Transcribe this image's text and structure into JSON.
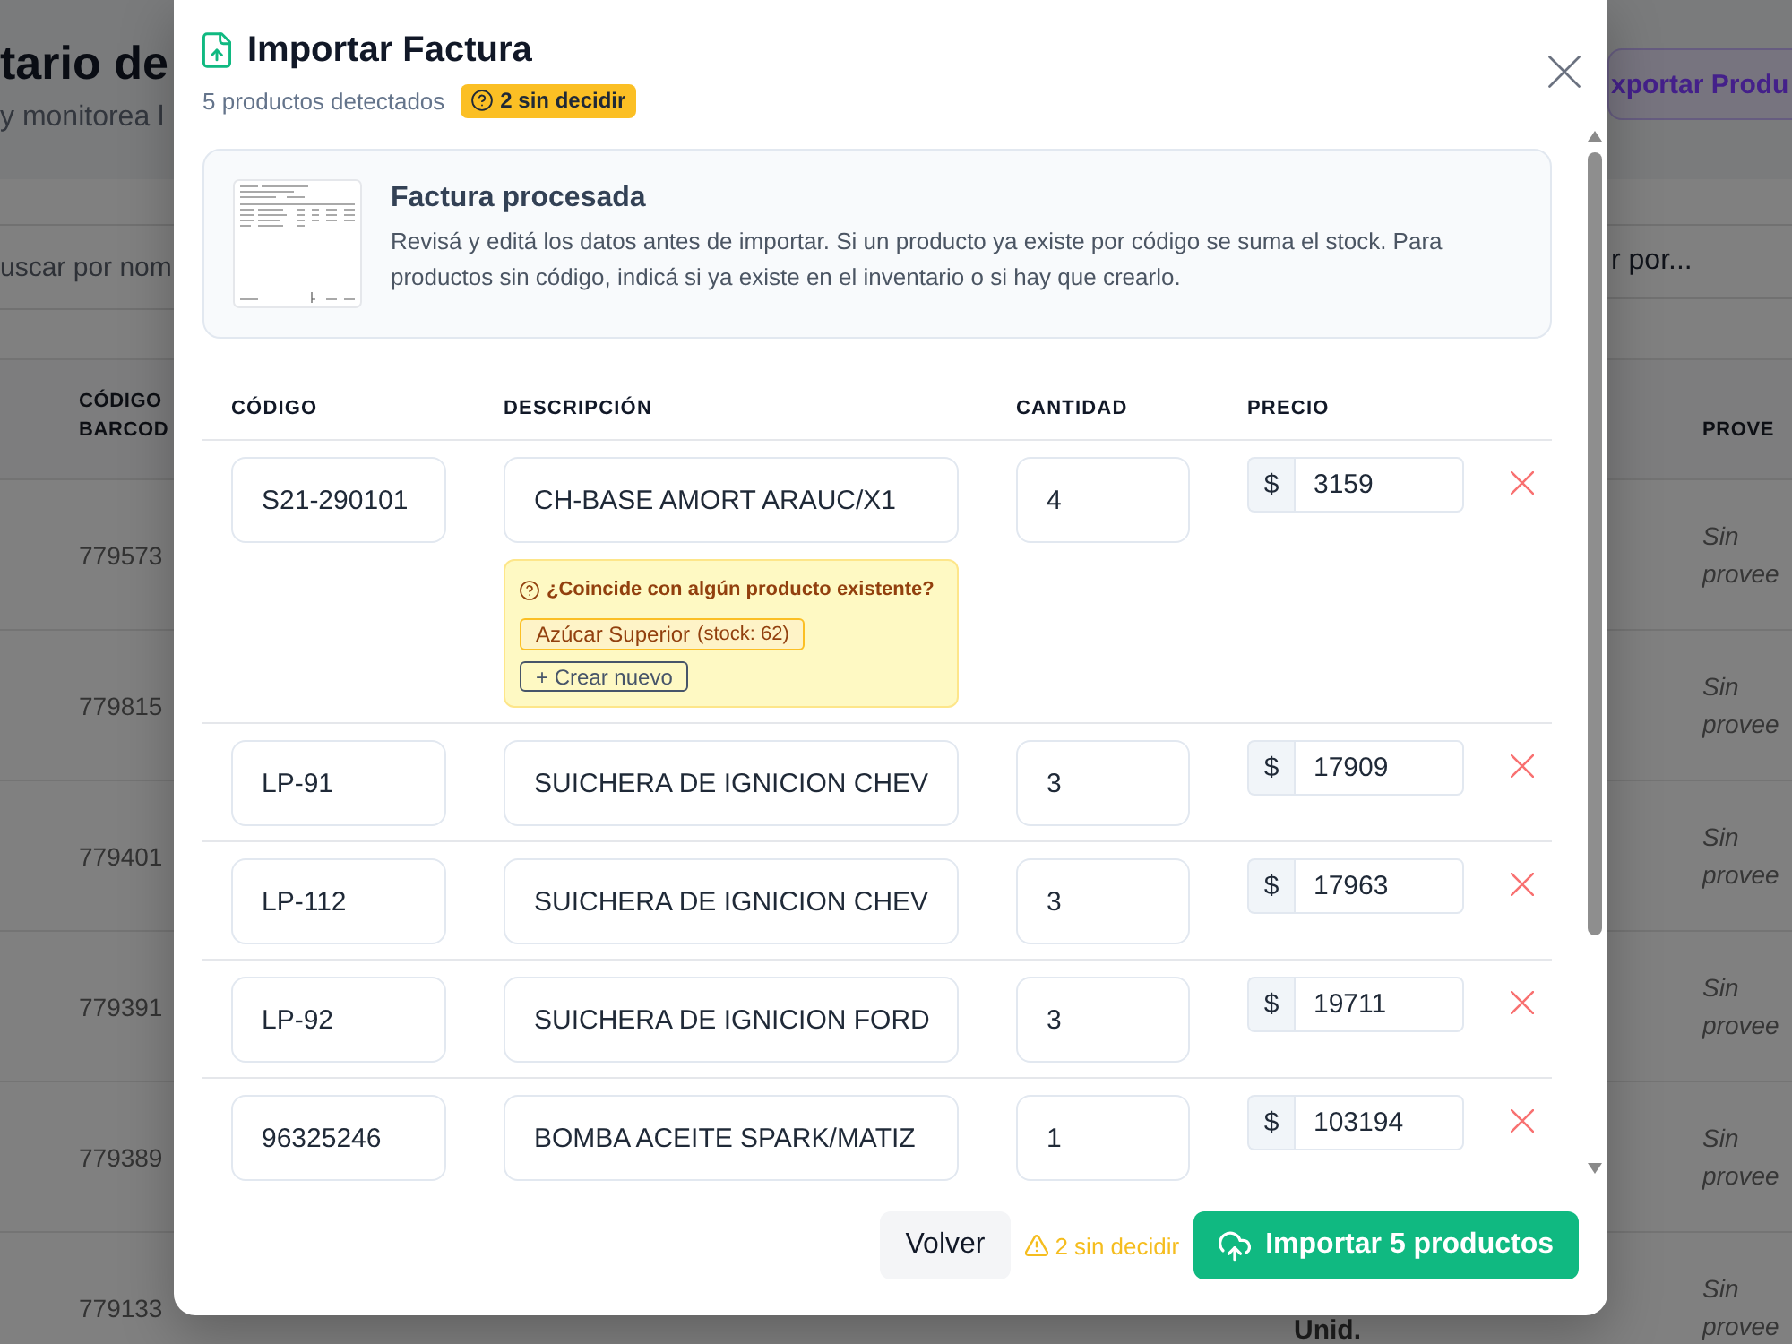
{
  "background_page": {
    "title": "tario de",
    "subtitle": "y monitorea l",
    "export_button": "xportar Produ",
    "search": {
      "placeholder": "uscar por nom"
    },
    "sort_select": {
      "value": "r por..."
    },
    "table": {
      "columns": [
        {
          "label": "CÓDIGO BARCOD"
        },
        {
          "label": "PROVE"
        }
      ],
      "rows": [
        {
          "code": "779573",
          "supplier": "Sin provee"
        },
        {
          "code": "779815",
          "supplier": "Sin provee"
        },
        {
          "code": "779401",
          "supplier": "Sin provee"
        },
        {
          "code": "779391",
          "supplier": "Sin provee"
        },
        {
          "code": "779389",
          "supplier": "Sin provee"
        },
        {
          "code": "779133",
          "unit": "Unid.",
          "supplier": "Sin provee"
        }
      ]
    }
  },
  "modal": {
    "title": "Importar Factura",
    "subtitle": "5 productos detectados",
    "badge": "2 sin decidir",
    "info": {
      "title": "Factura procesada",
      "text": "Revisá y editá los datos antes de importar. Si un producto ya existe por código se suma el stock. Para productos sin código, indicá si ya existe en el inventario o si hay que crearlo."
    },
    "columns": [
      {
        "label": "CÓDIGO"
      },
      {
        "label": "DESCRIPCIÓN"
      },
      {
        "label": "CANTIDAD"
      },
      {
        "label": "PRECIO"
      }
    ],
    "rows": [
      {
        "code": "S21-290101",
        "description": "CH-BASE AMORT ARAUC/X1",
        "quantity": "4",
        "currency": "$",
        "price": "3159",
        "match": {
          "question": "¿Coincide con algún producto existente?",
          "options": [
            {
              "kind": "existing",
              "label": "Azúcar Superior",
              "note": "(stock: 62)"
            },
            {
              "kind": "create",
              "label": "+ Crear nuevo"
            }
          ]
        }
      },
      {
        "code": "LP-91",
        "description": "SUICHERA DE IGNICION CHEV",
        "quantity": "3",
        "currency": "$",
        "price": "17909"
      },
      {
        "code": "LP-112",
        "description": "SUICHERA DE IGNICION CHEV",
        "quantity": "3",
        "currency": "$",
        "price": "17963"
      },
      {
        "code": "LP-92",
        "description": "SUICHERA DE IGNICION FORD",
        "quantity": "3",
        "currency": "$",
        "price": "19711"
      },
      {
        "code": "96325246",
        "description": "BOMBA ACEITE SPARK/MATIZ",
        "quantity": "1",
        "currency": "$",
        "price": "103194"
      }
    ],
    "footer": {
      "back_button": "Volver",
      "warning": "2 sin decidir",
      "import_button": "Importar 5 productos"
    }
  }
}
